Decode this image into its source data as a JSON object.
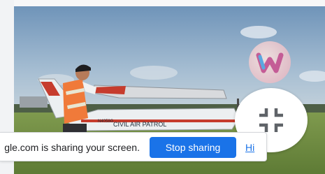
{
  "video": {
    "aircraft_text": "CIVIL AIR PATROL",
    "tail_text": "N4058G"
  },
  "sharing_bar": {
    "message": "gle.com is sharing your screen.",
    "stop_label": "Stop sharing",
    "hide_label": "Hi"
  },
  "colors": {
    "stop_button": "#1a73e8",
    "link": "#1a73e8",
    "vest": "#f07a3a"
  },
  "icons": {
    "pip_exit": "exit-fullscreen-icon",
    "app_logo": "w-logo-icon"
  }
}
